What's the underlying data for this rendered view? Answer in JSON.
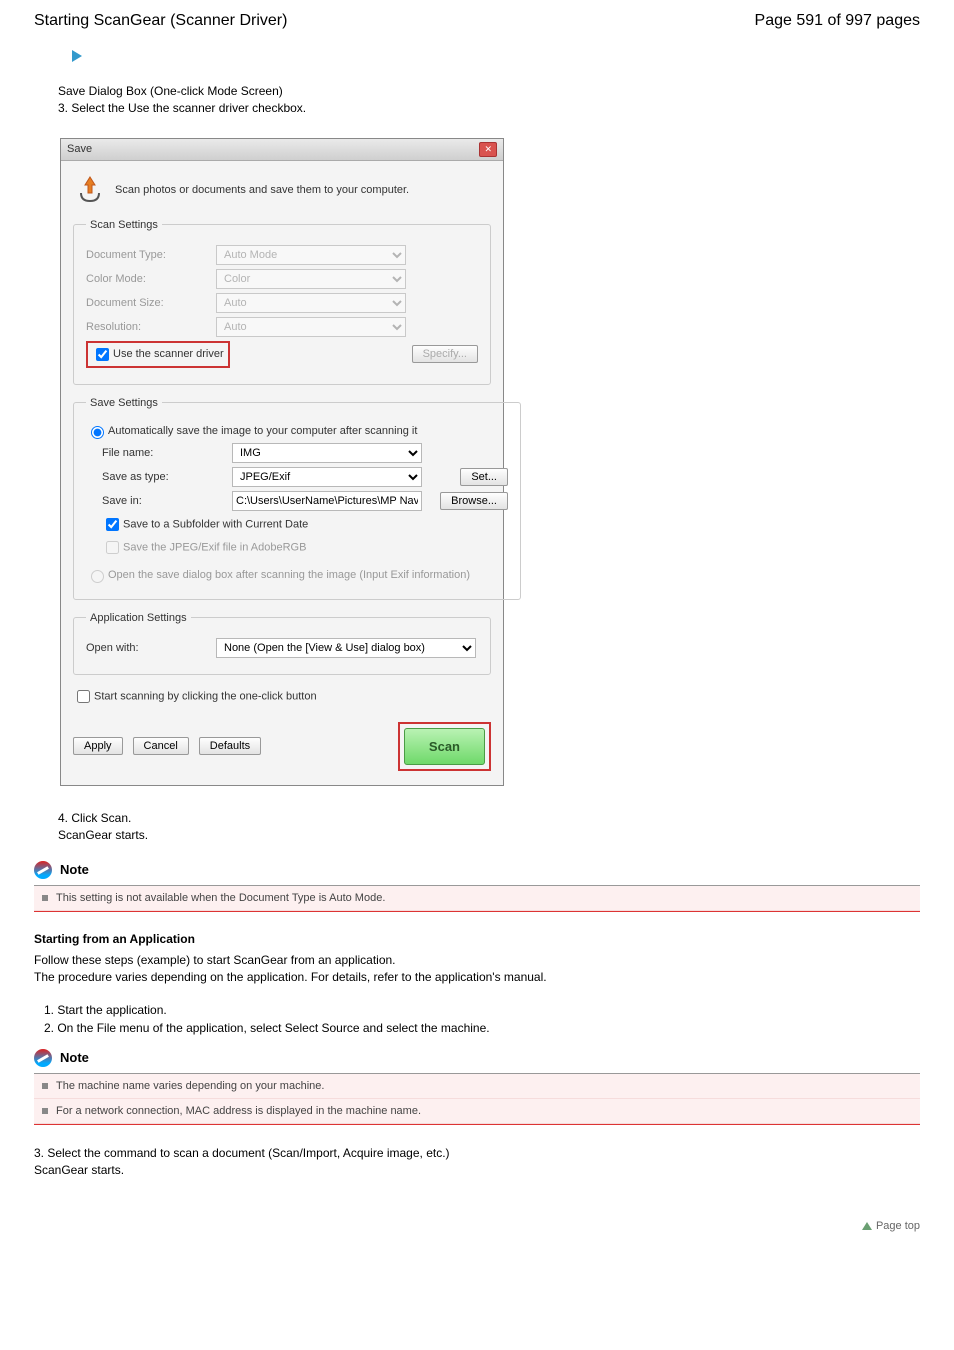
{
  "header": {
    "left": "Starting ScanGear (Scanner Driver)",
    "right": "Page 591 of 997 pages"
  },
  "intro": "Save Dialog Box (One-click Mode Screen)\n3. Select the Use the scanner driver checkbox.",
  "dialog": {
    "title": "Save",
    "banner": "Scan photos or documents and save them to your computer.",
    "scanSettings": {
      "legend": "Scan Settings",
      "docType": {
        "label": "Document Type:",
        "value": "Auto Mode"
      },
      "colorMode": {
        "label": "Color Mode:",
        "value": "Color"
      },
      "docSize": {
        "label": "Document Size:",
        "value": "Auto"
      },
      "resolution": {
        "label": "Resolution:",
        "value": "Auto"
      },
      "useDriver": "Use the scanner driver",
      "specify": "Specify..."
    },
    "saveSettings": {
      "legend": "Save Settings",
      "autoSave": "Automatically save the image to your computer after scanning it",
      "fileName": {
        "label": "File name:",
        "value": "IMG"
      },
      "saveAs": {
        "label": "Save as type:",
        "value": "JPEG/Exif",
        "btn": "Set..."
      },
      "saveIn": {
        "label": "Save in:",
        "value": "C:\\Users\\UserName\\Pictures\\MP Navigato",
        "btn": "Browse..."
      },
      "subfolder": "Save to a Subfolder with Current Date",
      "adobeRGB": "Save the JPEG/Exif file in AdobeRGB",
      "openDlg": "Open the save dialog box after scanning the image (Input Exif information)"
    },
    "appSettings": {
      "legend": "Application Settings",
      "openWith": {
        "label": "Open with:",
        "value": "None (Open the [View & Use] dialog box)"
      }
    },
    "startOneClick": "Start scanning by clicking the one-click button",
    "footer": {
      "apply": "Apply",
      "cancel": "Cancel",
      "defaults": "Defaults",
      "scan": "Scan"
    }
  },
  "afterDialog": "4. Click Scan.\nScanGear starts.",
  "noteLabel": "Note",
  "note1": "This setting is not available when the Document Type is Auto Mode.",
  "fromApp": {
    "heading": "Starting from an Application",
    "para1": "Follow these steps (example) to start ScanGear from an application.\nThe procedure varies depending on the application. For details, refer to the application's manual.",
    "step1": "1. Start the application.",
    "step2": "2. On the File menu of the application, select Select Source and select the machine.",
    "note_a": "The machine name varies depending on your machine.",
    "note_b": "For a network connection, MAC address is displayed in the machine name.",
    "step3": "3. Select the command to scan a document (Scan/Import, Acquire image, etc.)\nScanGear starts.",
    "pagetop": "Page top"
  }
}
